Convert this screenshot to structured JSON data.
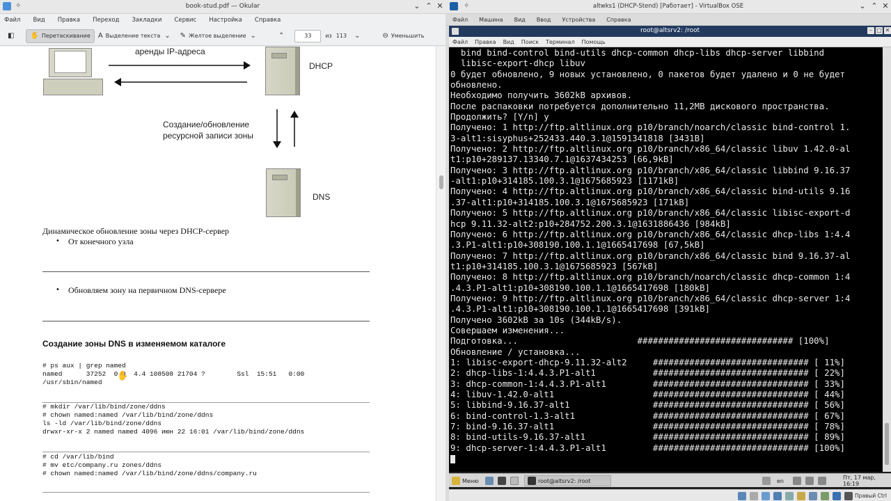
{
  "okular": {
    "window_title": "book-stud.pdf — Okular",
    "menu": [
      "Файл",
      "Вид",
      "Правка",
      "Переход",
      "Закладки",
      "Сервис",
      "Настройка",
      "Справка"
    ],
    "toolbar": {
      "drag_label": "Перетаскивание",
      "text_select_label": "Выделение текста",
      "highlight_label": "Желтое выделение",
      "page_current": "33",
      "page_of": "из",
      "page_total": "113",
      "zoom_out_label": "Уменьшить"
    },
    "document": {
      "diagram": {
        "lease_label": "аренды IP-адреса",
        "dhcp_label": "DHCP",
        "update_label_1": "Создание/обновление",
        "update_label_2": "ресурсной записи зоны",
        "dns_label": "DNS"
      },
      "caption": "Динамическое обновление зоны через DHCP-сервер",
      "bullet_1": "От конечного узла",
      "bullet_2": "Обновляем зону на первичном DNS-сервере",
      "heading": "Создание зоны DNS в изменяемом каталоге",
      "code_1": "# ps aux | grep named\nnamed      37252  0.0  4.4 108508 21704 ?        Ssl  15:51   0:00\n/usr/sbin/named",
      "code_2": "# mkdir /var/lib/bind/zone/ddns\n# chown named:named /var/lib/bind/zone/ddns\nls -ld /var/lib/bind/zone/ddns\ndrwxr-xr-x 2 named named 4096 июн 22 16:01 /var/lib/bind/zone/ddns",
      "code_3": "# cd /var/lib/bind\n# mv etc/company.ru zones/ddns\n# chown named:named /var/lib/bind/zone/ddns/company.ru"
    }
  },
  "vbox": {
    "window_title": "altwks1 (DHCP-Stend) [Работает] - VirtualBox OSE",
    "menu": [
      "Файл",
      "Машина",
      "Вид",
      "Ввод",
      "Устройства",
      "Справка"
    ],
    "terminal": {
      "title": "root@altsrv2: /root",
      "menu": [
        "Файл",
        "Правка",
        "Вид",
        "Поиск",
        "Терминал",
        "Помощь"
      ],
      "lines": [
        "  bind bind-control bind-utils dhcp-common dhcp-libs dhcp-server libbind",
        "  libisc-export-dhcp libuv",
        "0 будет обновлено, 9 новых установлено, 0 пакетов будет удалено и 0 не будет",
        "обновлено.",
        "Необходимо получить 3602kB архивов.",
        "После распаковки потребуется дополнительно 11,2MB дискового пространства.",
        "Продолжить? [Y/n] y",
        "Получено: 1 http://ftp.altlinux.org p10/branch/noarch/classic bind-control 1.",
        "3-alt1:sisyphus+252433.440.3.1@1591341818 [3431B]",
        "Получено: 2 http://ftp.altlinux.org p10/branch/x86_64/classic libuv 1.42.0-al",
        "t1:p10+289137.13340.7.1@1637434253 [66,9kB]",
        "Получено: 3 http://ftp.altlinux.org p10/branch/x86_64/classic libbind 9.16.37",
        "-alt1:p10+314185.100.3.1@1675685923 [1171kB]",
        "Получено: 4 http://ftp.altlinux.org p10/branch/x86_64/classic bind-utils 9.16",
        ".37-alt1:p10+314185.100.3.1@1675685923 [171kB]",
        "Получено: 5 http://ftp.altlinux.org p10/branch/x86_64/classic libisc-export-d",
        "hcp 9.11.32-alt2:p10+284752.200.3.1@1631886436 [984kB]",
        "Получено: 6 http://ftp.altlinux.org p10/branch/x86_64/classic dhcp-libs 1:4.4",
        ".3.P1-alt1:p10+308190.100.1.1@1665417698 [67,5kB]",
        "Получено: 7 http://ftp.altlinux.org p10/branch/x86_64/classic bind 9.16.37-al",
        "t1:p10+314185.100.3.1@1675685923 [567kB]",
        "Получено: 8 http://ftp.altlinux.org p10/branch/noarch/classic dhcp-common 1:4",
        ".4.3.P1-alt1:p10+308190.100.1.1@1665417698 [180kB]",
        "Получено: 9 http://ftp.altlinux.org p10/branch/x86_64/classic dhcp-server 1:4",
        ".4.3.P1-alt1:p10+308190.100.1.1@1665417698 [391kB]",
        "Получено 3602kB за 10s (344kB/s).",
        "Совершаем изменения...",
        "Подготовка...                       ############################## [100%]",
        "Обновление / установка...",
        "1: libisc-export-dhcp-9.11.32-alt2     ############################## [ 11%]",
        "2: dhcp-libs-1:4.4.3.P1-alt1           ############################## [ 22%]",
        "3: dhcp-common-1:4.4.3.P1-alt1         ############################## [ 33%]",
        "4: libuv-1.42.0-alt1                   ############################## [ 44%]",
        "5: libbind-9.16.37-alt1                ############################## [ 56%]",
        "6: bind-control-1.3-alt1               ############################## [ 67%]",
        "7: bind-9.16.37-alt1                   ############################## [ 78%]",
        "8: bind-utils-9.16.37-alt1             ############################## [ 89%]",
        "9: dhcp-server-1:4.4.3.P1-alt1         ############################## [100%]"
      ]
    },
    "taskbar": {
      "menu_label": "Меню",
      "task_label": "root@altsrv2: /root",
      "lang": "en"
    },
    "status": {
      "host_key": "Правый Ctrl",
      "clock": "Пт, 17 мар, 16:19"
    }
  }
}
